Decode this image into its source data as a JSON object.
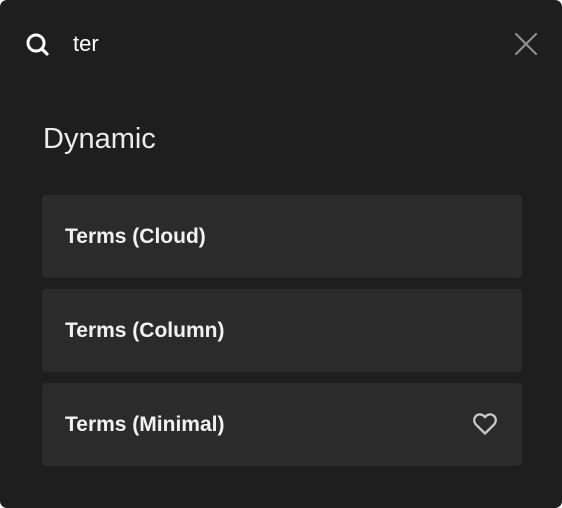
{
  "search": {
    "value": "ter"
  },
  "section": {
    "title": "Dynamic"
  },
  "results": [
    {
      "label": "Terms (Cloud)",
      "favorite_icon": false
    },
    {
      "label": "Terms (Column)",
      "favorite_icon": false
    },
    {
      "label": "Terms (Minimal)",
      "favorite_icon": "heart-outline-icon"
    }
  ],
  "colors": {
    "panel_bg": "#1e1e1e",
    "item_bg": "#2b2b2b",
    "text": "#f2f2f2",
    "icon": "#c8c8c8"
  },
  "icons": {
    "search": "search-icon",
    "close": "close-icon",
    "favorite": "heart-outline-icon"
  }
}
